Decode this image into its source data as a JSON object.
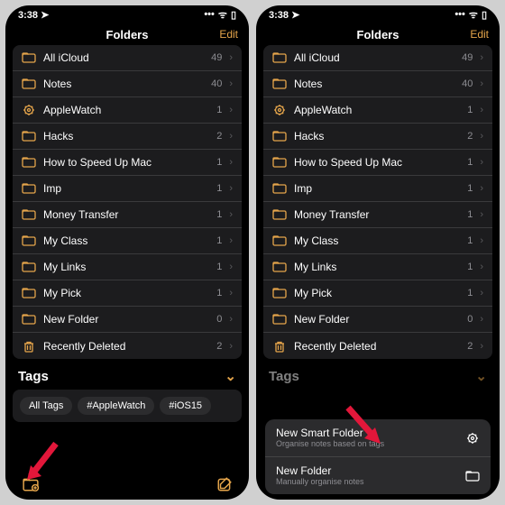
{
  "status": {
    "time": "3:38",
    "loc_glyph": "➤",
    "sig_glyph": "ııı",
    "wifi_glyph": "⋮",
    "batt_glyph": "▢"
  },
  "nav": {
    "title": "Folders",
    "edit": "Edit"
  },
  "folders": [
    {
      "icon": "folder",
      "name": "All iCloud",
      "count": 49
    },
    {
      "icon": "folder",
      "name": "Notes",
      "count": 40
    },
    {
      "icon": "gear",
      "name": "AppleWatch",
      "count": 1
    },
    {
      "icon": "folder",
      "name": "Hacks",
      "count": 2
    },
    {
      "icon": "folder",
      "name": "How to Speed Up Mac",
      "count": 1
    },
    {
      "icon": "folder",
      "name": "Imp",
      "count": 1
    },
    {
      "icon": "folder",
      "name": "Money Transfer",
      "count": 1
    },
    {
      "icon": "folder",
      "name": "My Class",
      "count": 1
    },
    {
      "icon": "folder",
      "name": "My Links",
      "count": 1
    },
    {
      "icon": "folder",
      "name": "My Pick",
      "count": 1
    },
    {
      "icon": "folder",
      "name": "New Folder",
      "count": 0
    },
    {
      "icon": "trash",
      "name": "Recently Deleted",
      "count": 2
    }
  ],
  "tags_header": "Tags",
  "tags": [
    "All Tags",
    "#AppleWatch",
    "#iOS15"
  ],
  "popup": {
    "smart_title": "New Smart Folder",
    "smart_sub": "Organise notes based on tags",
    "folder_title": "New Folder",
    "folder_sub": "Manually organise notes"
  }
}
